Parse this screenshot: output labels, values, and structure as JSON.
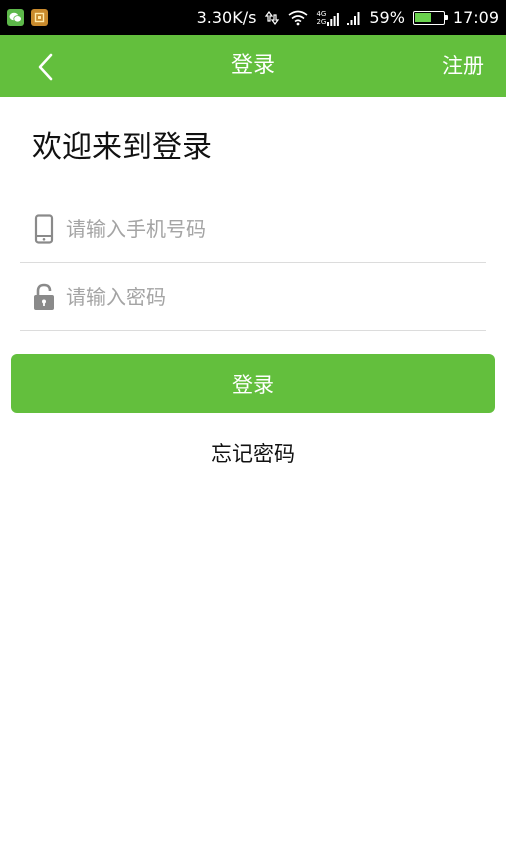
{
  "status_bar": {
    "speed": "3.30K/s",
    "network_label_top": "4G",
    "network_label_bottom": "2G",
    "battery_percent": "59%",
    "battery_level": 0.59,
    "time": "17:09"
  },
  "nav": {
    "title": "登录",
    "register_label": "注册"
  },
  "welcome_text": "欢迎来到登录",
  "form": {
    "phone_placeholder": "请输入手机号码",
    "phone_value": "",
    "password_placeholder": "请输入密码",
    "password_value": "",
    "login_button": "登录",
    "forgot_password": "忘记密码"
  },
  "colors": {
    "brand_green": "#63bf3d",
    "placeholder_gray": "#a4a4a4",
    "divider": "#dcdcdc"
  }
}
